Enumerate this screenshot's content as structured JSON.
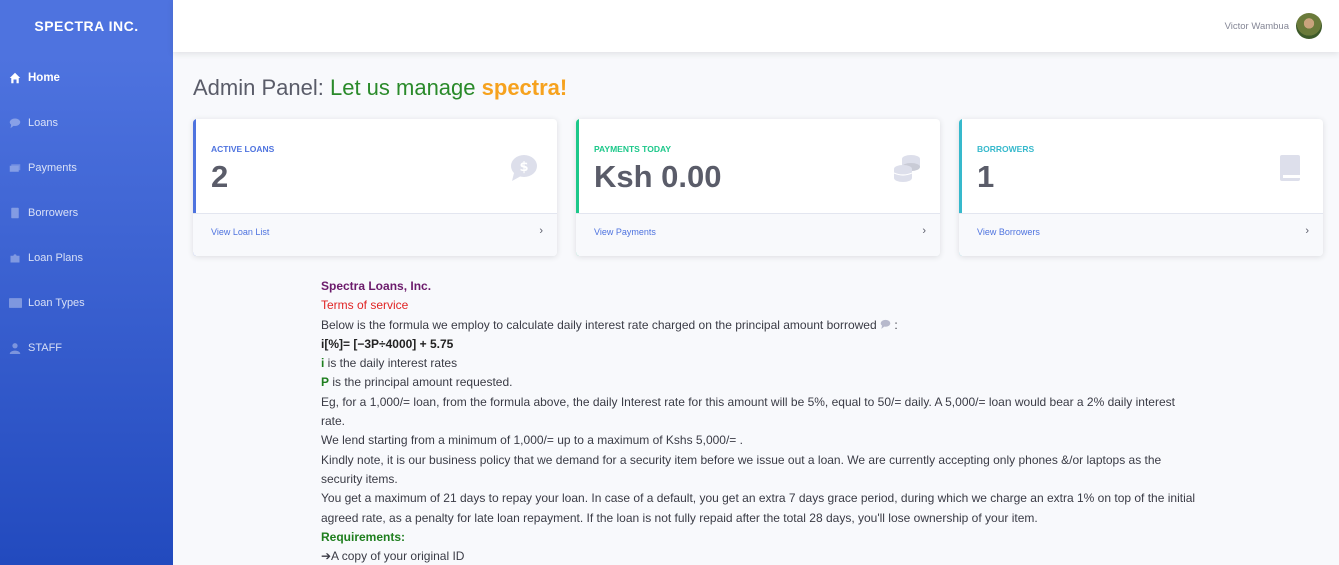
{
  "brand": "SPECTRA INC.",
  "sidebar": {
    "items": [
      {
        "label": "Home",
        "icon": "home-icon"
      },
      {
        "label": "Loans",
        "icon": "comment-icon"
      },
      {
        "label": "Payments",
        "icon": "money-icon"
      },
      {
        "label": "Borrowers",
        "icon": "book-icon"
      },
      {
        "label": "Loan Plans",
        "icon": "puzzle-icon"
      },
      {
        "label": "Loan Types",
        "icon": "card-icon"
      },
      {
        "label": "STAFF",
        "icon": "user-icon"
      }
    ]
  },
  "topbar": {
    "user_name": "Victor Wambua"
  },
  "page": {
    "title_prefix": "Admin Panel: ",
    "title_green": "Let us manage ",
    "title_orange": "spectra!"
  },
  "cards": [
    {
      "label": "ACTIVE LOANS",
      "value": "2",
      "footer": "View Loan List",
      "color": "#4e73df",
      "icon": "dollar-comment-icon"
    },
    {
      "label": "PAYMENTS TODAY",
      "value": "Ksh 0.00",
      "footer": "View Payments",
      "color": "#1cc88a",
      "icon": "coins-icon"
    },
    {
      "label": "BORROWERS",
      "value": "1",
      "footer": "View Borrowers",
      "color": "#36b9cc",
      "icon": "book-icon"
    }
  ],
  "terms": {
    "org": "Spectra Loans, Inc.",
    "tos": "Terms of service",
    "intro": "Below is the formula we employ to calculate daily interest rate charged on the principal amount borrowed",
    "intro_end": ":",
    "formula": "i[%]= [−3P÷4000] + 5.75",
    "i_var": "i",
    "i_desc": " is the daily interest rates",
    "p_var": "P",
    "p_desc": " is the principal amount requested.",
    "example": "Eg, for a 1,000/= loan, from the formula above, the daily Interest rate for this amount will be 5%, equal to 50/= daily. A 5,000/= loan would bear a 2% daily interest rate.",
    "range": "We lend starting from a minimum of 1,000/= up to a maximum of Kshs 5,000/= .",
    "security": "Kindly note, it is our business policy that we demand for a security item before we issue out a loan. We are currently accepting only phones &/or laptops as the security items.",
    "repay": "You get a maximum of 21 days to repay your loan. In case of a default, you get an extra 7 days grace period, during which we charge an extra 1% on top of the initial agreed rate, as a penalty for late loan repayment. If the loan is not fully repaid after the total 28 days, you'll lose ownership of your item.",
    "requirements": "Requirements:",
    "req1": "➔A copy of your original ID"
  }
}
